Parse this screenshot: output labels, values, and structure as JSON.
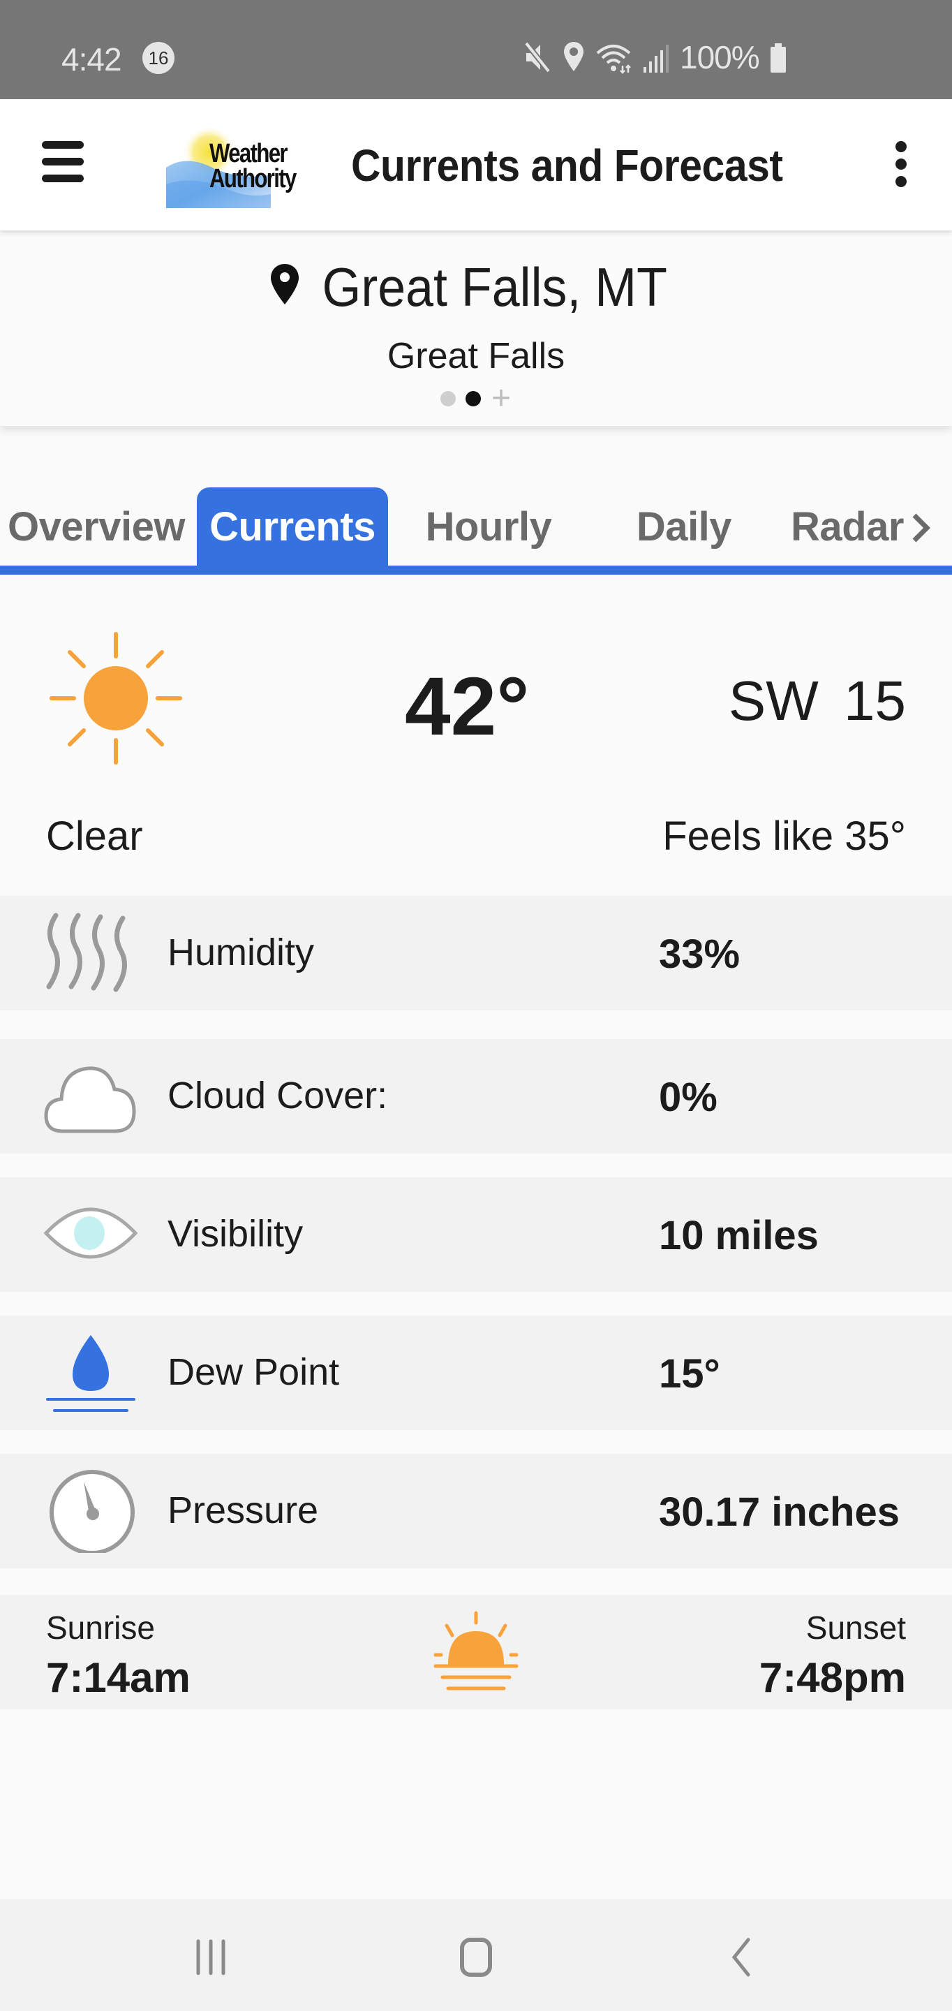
{
  "status_bar": {
    "time": "4:42",
    "notification_count": "16",
    "battery": "100%",
    "icons": [
      "mute-icon",
      "location-icon",
      "wifi-icon",
      "signal-icon",
      "battery-icon"
    ]
  },
  "app_bar": {
    "logo_line1": "Weather",
    "logo_line2": "Authority",
    "title": "Currents and Forecast",
    "menu_icon": "hamburger-icon",
    "overflow_icon": "more-vertical-icon"
  },
  "location": {
    "name": "Great Falls, MT",
    "subtitle": "Great Falls",
    "pages": {
      "count": 2,
      "active_index": 1
    },
    "add_label": "+"
  },
  "tabs": [
    {
      "label": "Overview",
      "active": false
    },
    {
      "label": "Currents",
      "active": true
    },
    {
      "label": "Hourly",
      "active": false
    },
    {
      "label": "Daily",
      "active": false
    },
    {
      "label": "Radar",
      "active": false
    }
  ],
  "current": {
    "icon": "sun-icon",
    "temperature": "42°",
    "wind": "SW 15",
    "condition": "Clear",
    "feels_like": "Feels like 35°"
  },
  "metrics": [
    {
      "icon": "humidity-icon",
      "label": "Humidity",
      "value": "33%"
    },
    {
      "icon": "cloud-icon",
      "label": "Cloud Cover:",
      "value": "0%"
    },
    {
      "icon": "eye-icon",
      "label": "Visibility",
      "value": "10 miles"
    },
    {
      "icon": "dew-point-icon",
      "label": "Dew Point",
      "value": "15°"
    },
    {
      "icon": "pressure-gauge-icon",
      "label": "Pressure",
      "value": "30.17 inches"
    }
  ],
  "sun": {
    "sunrise_label": "Sunrise",
    "sunrise_time": "7:14am",
    "sunset_label": "Sunset",
    "sunset_time": "7:48pm"
  },
  "colors": {
    "accent": "#3572e0",
    "sun": "#f7a23a",
    "dew": "#3572e0",
    "status_bar": "#767676"
  },
  "nav_bar": {
    "buttons": [
      "recent-apps",
      "home",
      "back"
    ]
  }
}
